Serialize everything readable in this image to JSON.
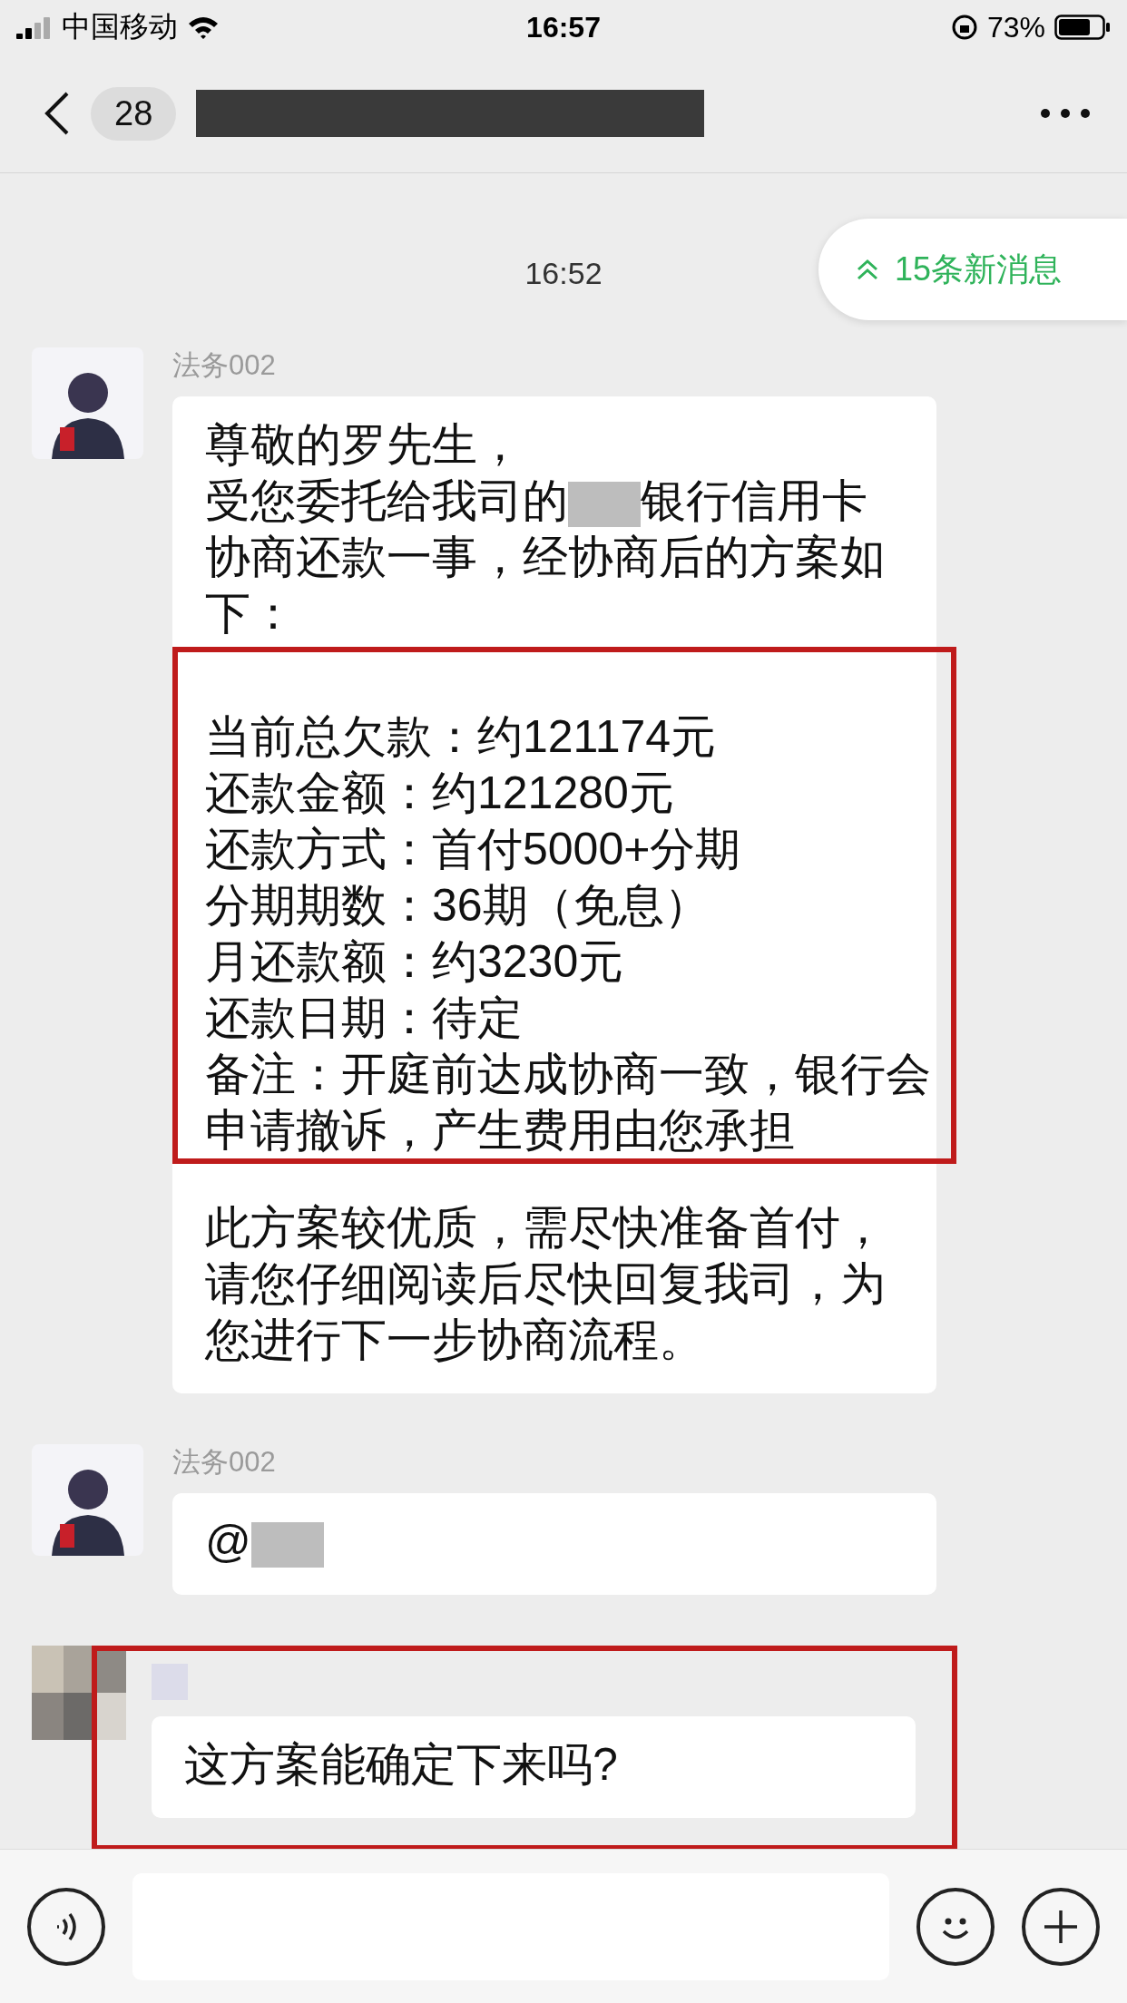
{
  "status_bar": {
    "carrier": "中国移动",
    "time": "16:57",
    "battery": "73%"
  },
  "nav": {
    "unread_count": "28"
  },
  "chat": {
    "time": "16:52",
    "new_messages": "15条新消息",
    "messages": [
      {
        "kind": "agent",
        "sender": "法务002",
        "content": [
          {
            "kind": "text",
            "text": "尊敬的罗先生，"
          },
          {
            "kind": "redacted_text",
            "before": "受您委托给我司的",
            "after": "银行信用卡协商还款一事，经协商后的方案如下："
          },
          {
            "kind": "list",
            "highlighted": true,
            "items": [
              "当前总欠款：约121174元",
              "还款金额：约121280元",
              "还款方式：首付5000+分期",
              "分期期数：36期（免息）",
              "月还款额：约3230元",
              "还款日期：待定",
              "备注：开庭前达成协商一致，银行会申请撤诉，产生费用由您承担"
            ]
          },
          {
            "kind": "text",
            "text": "此方案较优质，需尽快准备首付，请您仔细阅读后尽快回复我司，为您进行下一步协商流程。"
          }
        ]
      },
      {
        "kind": "agent",
        "sender": "法务002",
        "content": [
          {
            "kind": "redacted_text",
            "before": "@"
          }
        ]
      },
      {
        "kind": "customer",
        "highlighted": true,
        "content": [
          {
            "kind": "text",
            "text": "这方案能确定下来吗?"
          }
        ]
      }
    ]
  }
}
